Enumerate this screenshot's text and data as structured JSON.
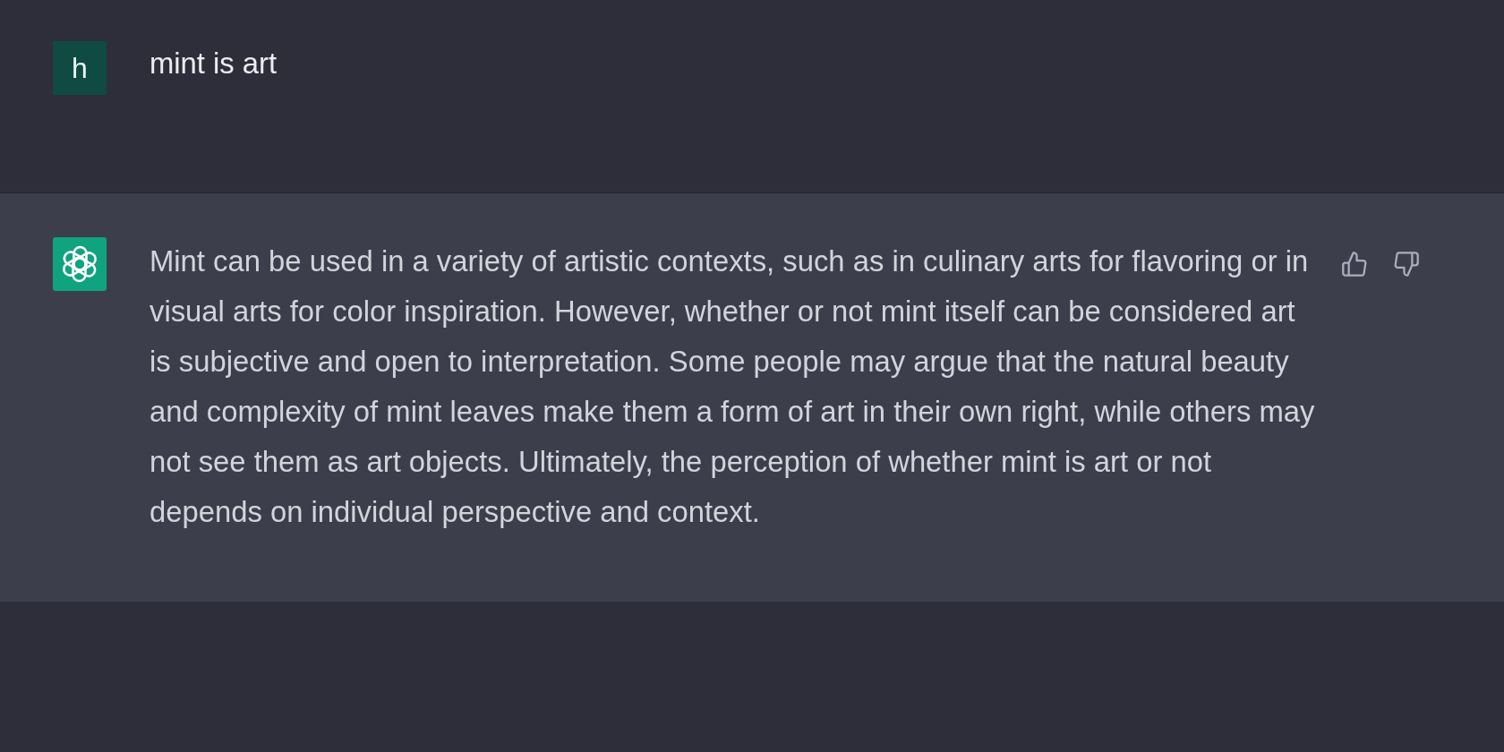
{
  "messages": [
    {
      "kind": "user",
      "avatar": "h",
      "text": "mint is art"
    },
    {
      "kind": "assistant",
      "text": "Mint can be used in a variety of artistic contexts, such as in culinary arts for flavoring or in visual arts for color inspiration. However, whether or not mint itself can be considered art is subjective and open to interpretation. Some people may argue that the natural beauty and complexity of mint leaves make them a form of art in their own right, while others may not see them as art objects. Ultimately, the perception of whether mint is art or not depends on individual perspective and context."
    }
  ]
}
